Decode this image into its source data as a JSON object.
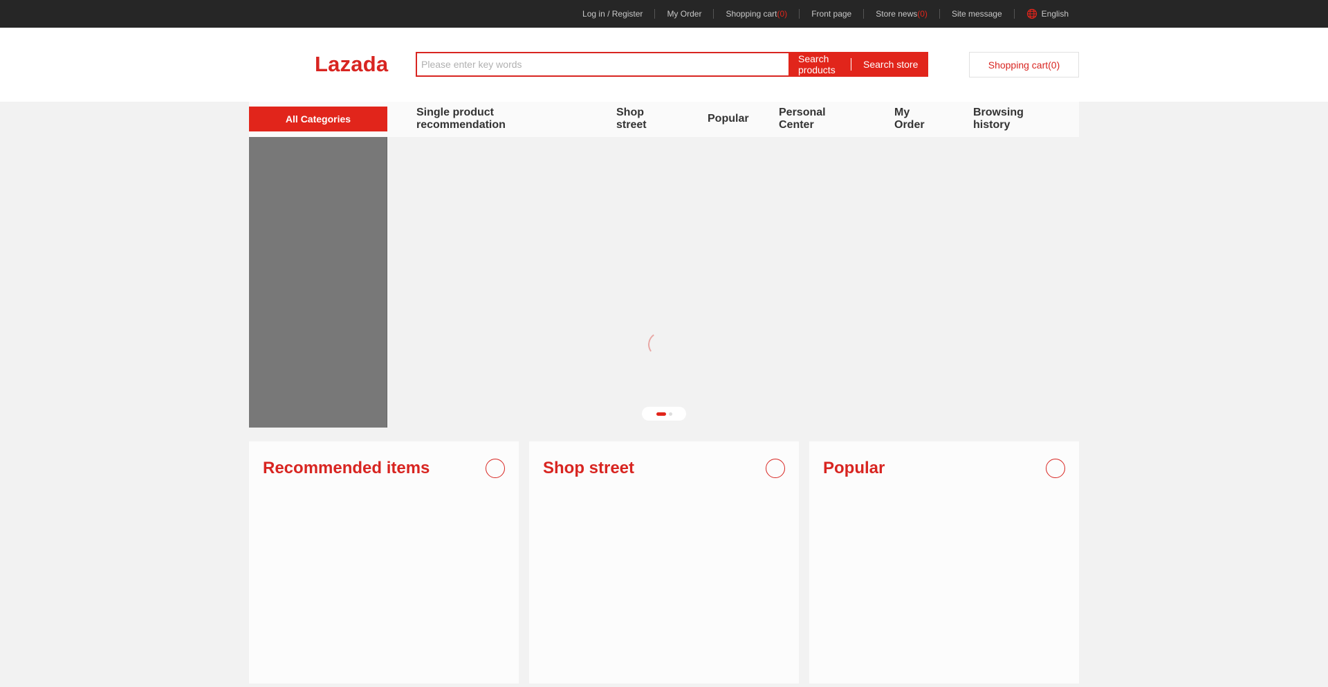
{
  "topbar": {
    "login_register": "Log in / Register",
    "my_order": "My Order",
    "shopping_cart": "Shopping cart",
    "shopping_cart_count": "(0)",
    "front_page": "Front page",
    "store_news": "Store news",
    "store_news_count": "(0)",
    "site_message": "Site message",
    "language": "English",
    "language_icon": "globe-icon"
  },
  "header": {
    "logo": "Lazada",
    "search": {
      "placeholder": "Please enter key words",
      "value": ""
    },
    "search_products_label": "Search products",
    "search_store_label": "Search store",
    "cart_label": "Shopping cart(0)"
  },
  "nav": {
    "all_categories": "All Categories",
    "items": [
      {
        "label": "Single product recommendation"
      },
      {
        "label": "Shop street"
      },
      {
        "label": "Popular"
      },
      {
        "label": "Personal Center"
      },
      {
        "label": "My Order"
      },
      {
        "label": "Browsing history"
      }
    ]
  },
  "sections": [
    {
      "title": "Recommended items"
    },
    {
      "title": "Shop street"
    },
    {
      "title": "Popular"
    }
  ],
  "colors": {
    "accent": "#e1251b",
    "brand": "#d82521",
    "topbar": "#262626"
  }
}
